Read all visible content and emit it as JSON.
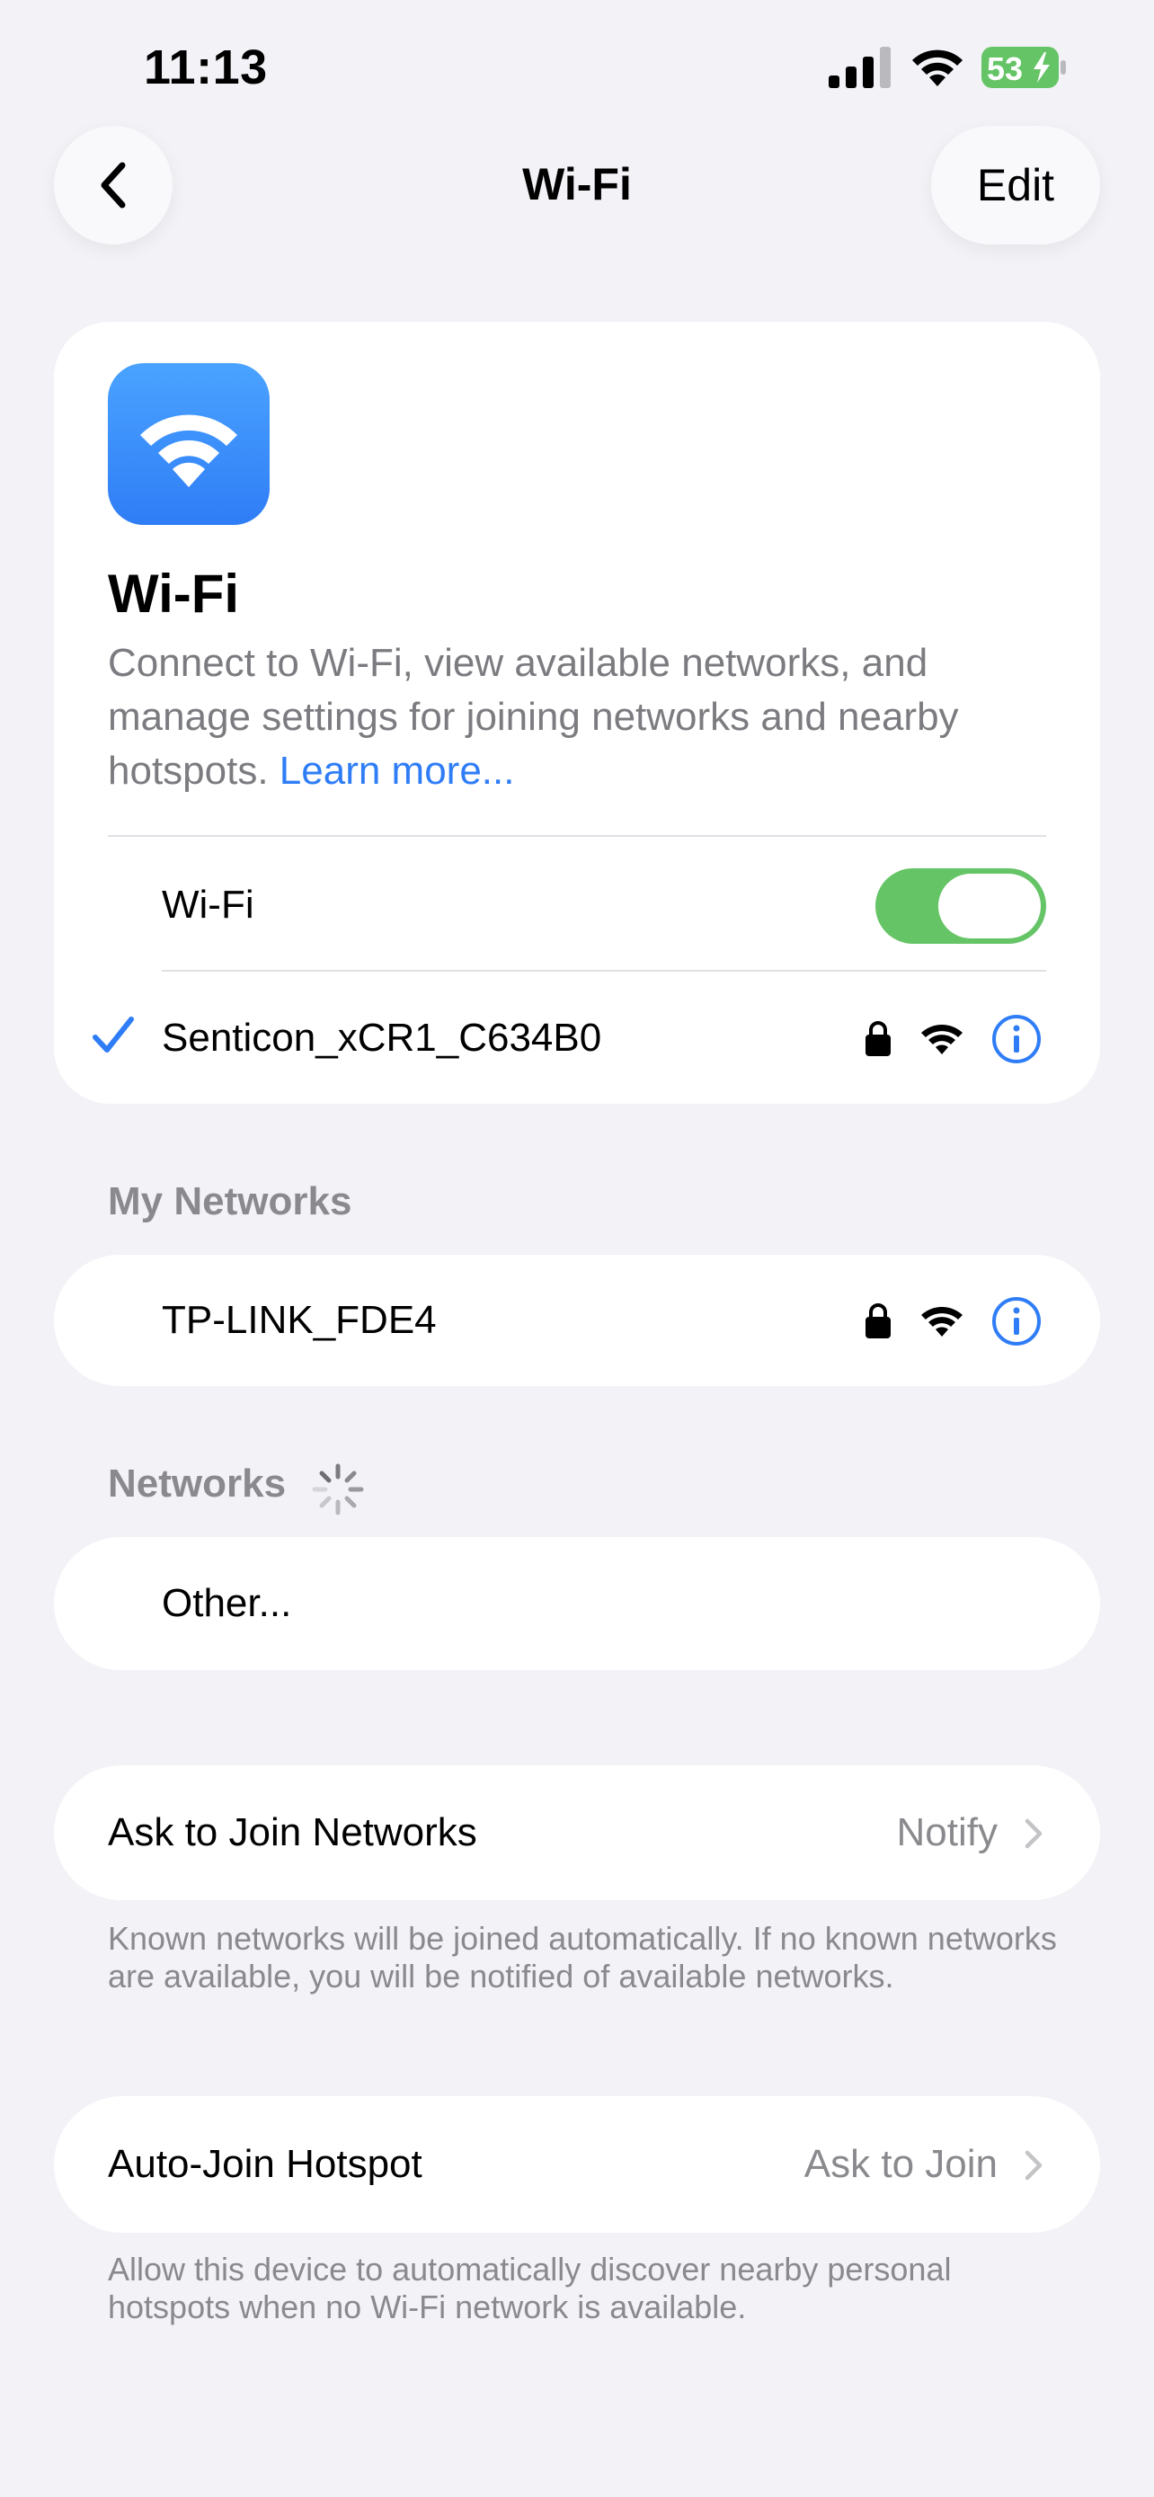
{
  "status_bar": {
    "time": "11:13",
    "battery_level": "53",
    "icons": [
      "cellular-signal-icon",
      "wifi-icon",
      "battery-charging-icon"
    ]
  },
  "nav": {
    "title": "Wi-Fi",
    "edit_label": "Edit",
    "back_icon": "chevron-left-icon"
  },
  "header_card": {
    "heading": "Wi-Fi",
    "description": "Connect to Wi-Fi, view available networks, and manage settings for joining networks and nearby hotspots.",
    "learn_more": "Learn more..."
  },
  "wifi_toggle": {
    "label": "Wi-Fi",
    "on": true
  },
  "connected_network": {
    "name": "Senticon_xCR1_C634B0",
    "secured": true
  },
  "my_networks": {
    "header": "My Networks",
    "items": [
      {
        "name": "TP-LINK_FDE4",
        "secured": true
      }
    ]
  },
  "networks": {
    "header": "Networks",
    "other_label": "Other..."
  },
  "ask_to_join": {
    "label": "Ask to Join Networks",
    "value": "Notify",
    "footer": "Known networks will be joined automatically. If no known networks are available, you will be notified of available networks."
  },
  "auto_join_hotspot": {
    "label": "Auto-Join Hotspot",
    "value": "Ask to Join",
    "footer": "Allow this device to automatically discover nearby personal hotspots when no Wi-Fi network is available."
  },
  "colors": {
    "accent": "#2f7df6",
    "toggle_on": "#65c466",
    "background": "#f2f2f7",
    "secondary_text": "#8a8a8e"
  }
}
